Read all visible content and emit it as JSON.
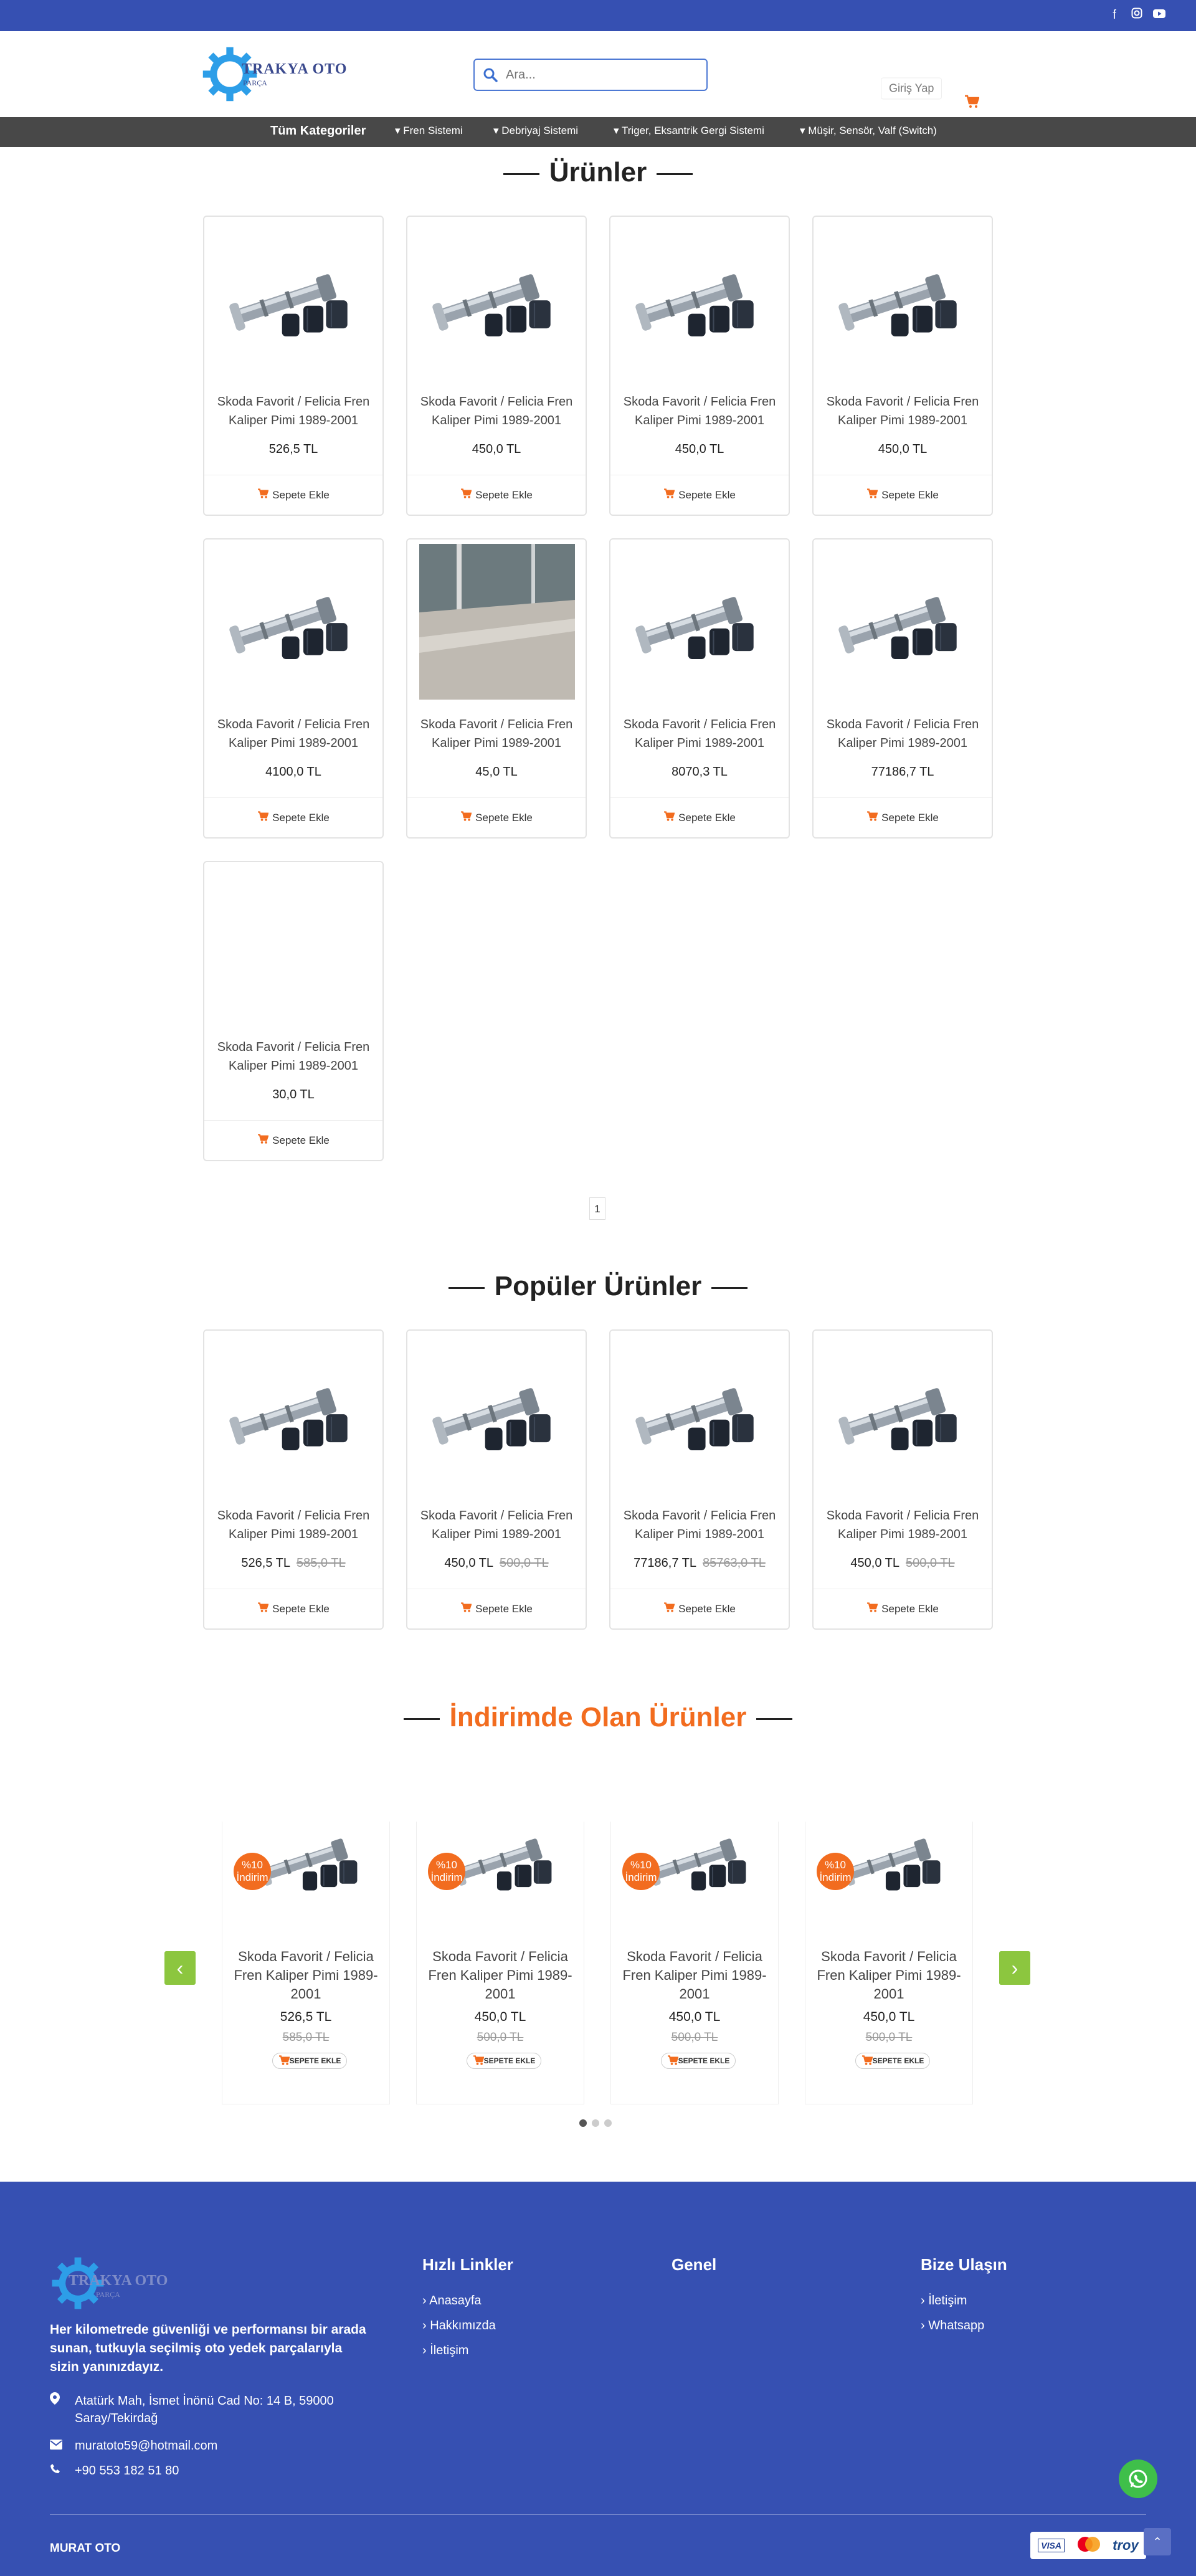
{
  "header": {
    "search_placeholder": "Ara...",
    "login_label": "Giriş Yap",
    "logo_name": "TRAKYA OTO",
    "logo_sub": "PARÇA"
  },
  "catbar": {
    "all_label": "Tüm Kategoriler",
    "items": [
      "Fren Sistemi",
      "Debriyaj Sistemi",
      "Triger, Eksantrik Gergi Sistemi",
      "Müşir, Sensör, Valf (Switch)"
    ]
  },
  "products_title": "Ürünler",
  "products": [
    {
      "name": "Skoda Favorit / Felicia Fren Kaliper Pimi 1989-2001",
      "price": "526,5 TL",
      "btn": "Sepete Ekle",
      "img": "pin"
    },
    {
      "name": "Skoda Favorit / Felicia Fren Kaliper Pimi 1989-2001",
      "price": "450,0 TL",
      "btn": "Sepete Ekle",
      "img": "pin"
    },
    {
      "name": "Skoda Favorit / Felicia Fren Kaliper Pimi 1989-2001",
      "price": "450,0 TL",
      "btn": "Sepete Ekle",
      "img": "pin"
    },
    {
      "name": "Skoda Favorit / Felicia Fren Kaliper Pimi 1989-2001",
      "price": "450,0 TL",
      "btn": "Sepete Ekle",
      "img": "pin"
    },
    {
      "name": "Skoda Favorit / Felicia Fren Kaliper Pimi 1989-2001",
      "price": "4100,0 TL",
      "btn": "Sepete Ekle",
      "img": "pin"
    },
    {
      "name": "Skoda Favorit / Felicia Fren Kaliper Pimi 1989-2001",
      "price": "45,0 TL",
      "btn": "Sepete Ekle",
      "img": "photo"
    },
    {
      "name": "Skoda Favorit / Felicia Fren Kaliper Pimi 1989-2001",
      "price": "8070,3 TL",
      "btn": "Sepete Ekle",
      "img": "pin"
    },
    {
      "name": "Skoda Favorit / Felicia Fren Kaliper Pimi 1989-2001",
      "price": "77186,7 TL",
      "btn": "Sepete Ekle",
      "img": "pin"
    },
    {
      "name": "Skoda Favorit / Felicia Fren Kaliper Pimi 1989-2001",
      "price": "30,0 TL",
      "btn": "Sepete Ekle",
      "img": "none"
    }
  ],
  "pagination": {
    "current": "1"
  },
  "popular_title": "Popüler Ürünler",
  "popular": [
    {
      "name": "Skoda Favorit / Felicia Fren Kaliper Pimi 1989-2001",
      "price": "526,5 TL",
      "old": "585,0 TL",
      "btn": "Sepete Ekle"
    },
    {
      "name": "Skoda Favorit / Felicia Fren Kaliper Pimi 1989-2001",
      "price": "450,0 TL",
      "old": "500,0 TL",
      "btn": "Sepete Ekle"
    },
    {
      "name": "Skoda Favorit / Felicia Fren Kaliper Pimi 1989-2001",
      "price": "77186,7 TL",
      "old": "85763,0 TL",
      "btn": "Sepete Ekle"
    },
    {
      "name": "Skoda Favorit / Felicia Fren Kaliper Pimi 1989-2001",
      "price": "450,0 TL",
      "old": "500,0 TL",
      "btn": "Sepete Ekle"
    }
  ],
  "discount_title": "İndirimde Olan Ürünler",
  "discount": [
    {
      "badge": "%10 İndirim",
      "name": "Skoda Favorit / Felicia Fren Kaliper Pimi 1989-2001",
      "price": "526,5 TL",
      "old": "585,0 TL",
      "btn": "SEPETE EKLE"
    },
    {
      "badge": "%10 İndirim",
      "name": "Skoda Favorit / Felicia Fren Kaliper Pimi 1989-2001",
      "price": "450,0 TL",
      "old": "500,0 TL",
      "btn": "SEPETE EKLE"
    },
    {
      "badge": "%10 İndirim",
      "name": "Skoda Favorit / Felicia Fren Kaliper Pimi 1989-2001",
      "price": "450,0 TL",
      "old": "500,0 TL",
      "btn": "SEPETE EKLE"
    },
    {
      "badge": "%10 İndirim",
      "name": "Skoda Favorit / Felicia Fren Kaliper Pimi 1989-2001",
      "price": "450,0 TL",
      "old": "500,0 TL",
      "btn": "SEPETE EKLE"
    }
  ],
  "footer": {
    "description": "Her kilometrede güvenliği ve performansı bir arada sunan, tutkuyla seçilmiş oto yedek parçalarıyla sizin yanınızdayız.",
    "address": "Atatürk Mah, İsmet İnönü Cad No: 14 B, 59000 Saray/Tekirdağ",
    "email": "muratoto59@hotmail.com",
    "phone": "+90 553 182 51 80",
    "quick_title": "Hızlı Linkler",
    "quick_links": [
      "Anasayfa",
      "Hakkımızda",
      "İletişim"
    ],
    "general_title": "Genel",
    "contact_title": "Bize Ulaşın",
    "contact_links": [
      "İletişim",
      "Whatsapp"
    ],
    "copyright": "MURAT OTO",
    "payments": [
      "VISA",
      "troy"
    ]
  },
  "colors": {
    "brand_blue": "#3650b2",
    "accent_orange": "#f26c1f",
    "nav_dark": "#484848",
    "arrow_green": "#8cc63f"
  }
}
